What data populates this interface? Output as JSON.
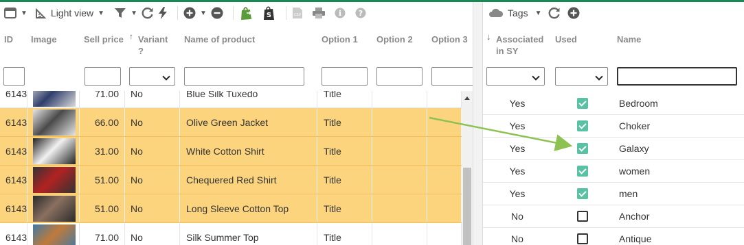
{
  "left_toolbar": {
    "view_label": "Light view"
  },
  "right_toolbar": {
    "tags_label": "Tags"
  },
  "left_headers": {
    "id": "ID",
    "image": "Image",
    "sell_price": "Sell price",
    "variant": "Variant ?",
    "name": "Name of product",
    "option1": "Option 1",
    "option2": "Option 2",
    "option3": "Option 3"
  },
  "right_headers": {
    "associated": "Associated in SY",
    "used": "Used",
    "name": "Name"
  },
  "products": [
    {
      "id": "6143",
      "price": "71.00",
      "variant": "No",
      "name": "Blue Silk Tuxedo",
      "option1": "Title",
      "selected": false
    },
    {
      "id": "6143",
      "price": "66.00",
      "variant": "No",
      "name": "Olive Green Jacket",
      "option1": "Title",
      "selected": true
    },
    {
      "id": "6143",
      "price": "31.00",
      "variant": "No",
      "name": "White Cotton Shirt",
      "option1": "Title",
      "selected": true
    },
    {
      "id": "6143",
      "price": "51.00",
      "variant": "No",
      "name": "Chequered Red Shirt",
      "option1": "Title",
      "selected": true
    },
    {
      "id": "6143",
      "price": "51.00",
      "variant": "No",
      "name": "Long Sleeve Cotton Top",
      "option1": "Title",
      "selected": true
    },
    {
      "id": "6143",
      "price": "71.00",
      "variant": "No",
      "name": "Silk Summer Top",
      "option1": "Title",
      "selected": false
    }
  ],
  "tags": [
    {
      "associated": "Yes",
      "used": true,
      "name": "Bedroom"
    },
    {
      "associated": "Yes",
      "used": true,
      "name": "Choker"
    },
    {
      "associated": "Yes",
      "used": true,
      "name": "Galaxy"
    },
    {
      "associated": "Yes",
      "used": true,
      "name": "women"
    },
    {
      "associated": "Yes",
      "used": true,
      "name": "men"
    },
    {
      "associated": "No",
      "used": false,
      "name": "Anchor"
    },
    {
      "associated": "No",
      "used": false,
      "name": "Antique"
    }
  ],
  "colors": {
    "selected_row": "#fcd47e",
    "accent_green": "#1a8754",
    "checkbox_on": "#5ac2a4",
    "arrow": "#8dc152"
  }
}
